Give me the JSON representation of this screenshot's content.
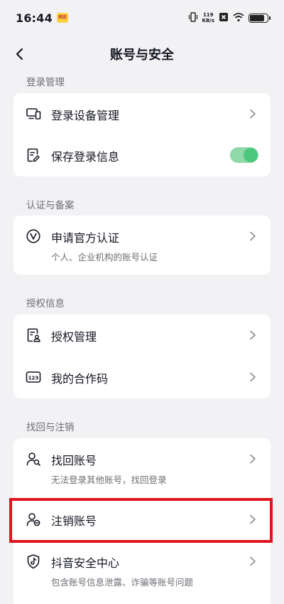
{
  "status_bar": {
    "time": "16:44",
    "badge_text": "美团",
    "net_speed_value": "119",
    "net_speed_unit": "KB/s",
    "battery_level": 0.85
  },
  "header": {
    "title": "账号与安全"
  },
  "sections": {
    "login": {
      "label": "登录管理",
      "items": [
        {
          "label": "登录设备管理"
        },
        {
          "label": "保存登录信息",
          "toggle_on": true
        }
      ]
    },
    "auth": {
      "label": "认证与备案",
      "items": [
        {
          "label": "申请官方认证",
          "sub": "个人、企业机构的账号认证"
        }
      ]
    },
    "authorization": {
      "label": "授权信息",
      "items": [
        {
          "label": "授权管理"
        },
        {
          "label": "我的合作码"
        }
      ]
    },
    "recover": {
      "label": "找回与注销",
      "items": [
        {
          "label": "找回账号",
          "sub": "无法登录其他账号，找回登录"
        },
        {
          "label": "注销账号"
        },
        {
          "label": "抖音安全中心",
          "sub": "包含账号信息泄露、诈骗等账号问题"
        }
      ]
    }
  },
  "colors": {
    "background": "#f2f2f4",
    "card": "#ffffff",
    "toggle_on": "#4cc77e",
    "highlight": "#e0141e"
  }
}
